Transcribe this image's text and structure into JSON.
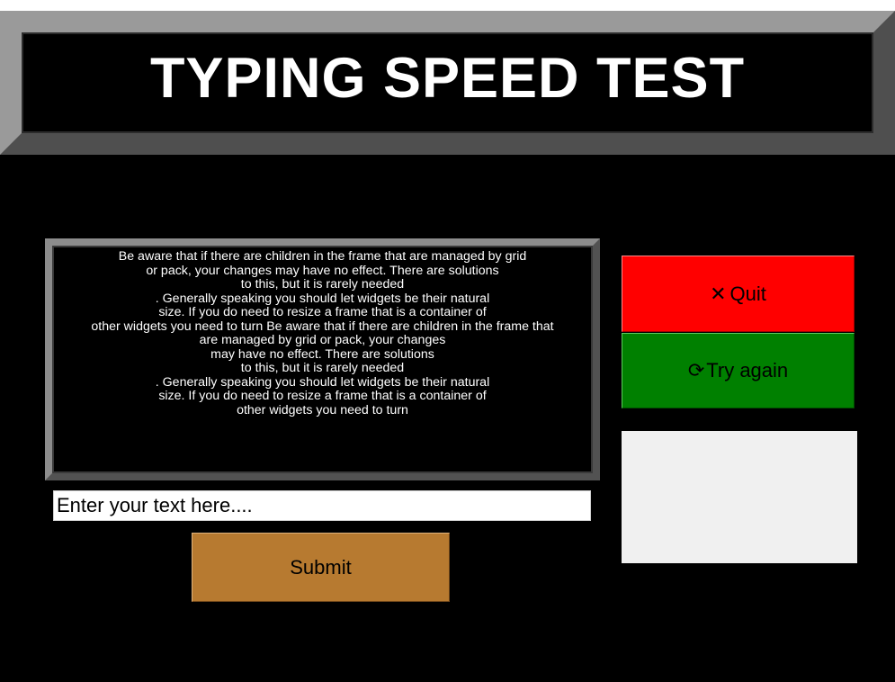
{
  "header": {
    "title": "TYPING SPEED TEST"
  },
  "passage": {
    "text": "Be aware that if there are children in the frame that are managed by grid\nor pack, your changes may have no effect. There are solutions\nto this, but it is rarely needed\n. Generally speaking you should let widgets be their natural\nsize. If you do need to resize a frame that is a container of\nother widgets you need to turn Be aware that if there are children in the frame that\nare managed by grid or pack, your changes\nmay have no effect. There are solutions\nto this, but it is rarely needed\n. Generally speaking you should let widgets be their natural\nsize. If you do need to resize a frame that is a container of\nother widgets you need to turn"
  },
  "input": {
    "value": "",
    "placeholder": "Enter your text here...."
  },
  "buttons": {
    "submit_label": "Submit",
    "quit_label": "Quit",
    "quit_icon": "✕",
    "retry_label": "Try again",
    "retry_icon": "⟳"
  },
  "result": {
    "text": ""
  },
  "colors": {
    "background": "#000000",
    "quit": "#ff0000",
    "retry": "#008000",
    "submit": "#b77a30",
    "result_box": "#f0f0f0"
  }
}
